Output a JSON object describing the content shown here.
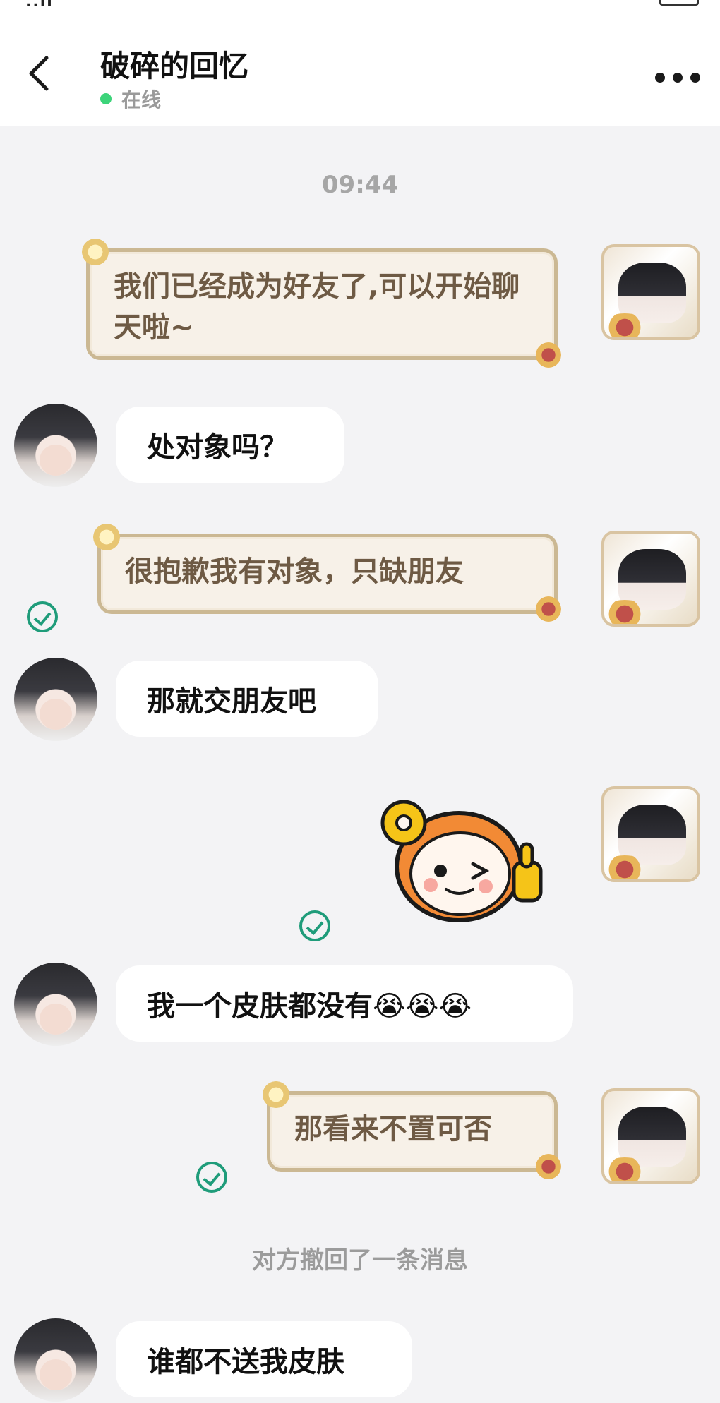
{
  "status_bar": {
    "signal": "..ıl"
  },
  "header": {
    "title": "破碎的回忆",
    "status": "在线"
  },
  "chat": {
    "timestamp": "09:44",
    "messages": [
      {
        "side": "out",
        "text": "我们已经成为好友了,可以开始聊天啦~"
      },
      {
        "side": "in",
        "text": "处对象吗？"
      },
      {
        "side": "out",
        "text": "很抱歉我有对象，只缺朋友"
      },
      {
        "side": "in",
        "text": "那就交朋友吧"
      },
      {
        "side": "out",
        "type": "sticker",
        "icon": "ok-thumbs-up-wink-sticker"
      },
      {
        "side": "in",
        "text": "我一个皮肤都没有😭😭😭"
      },
      {
        "side": "out",
        "text": "那看来不置可否"
      },
      {
        "side": "system",
        "text": "对方撤回了一条消息"
      },
      {
        "side": "in",
        "text": "谁都不送我皮肤"
      }
    ]
  },
  "colors": {
    "online": "#3dd47a",
    "read_check": "#1f9c7a",
    "outgoing_text": "#6e5a44",
    "outgoing_border": "#cbb893",
    "background": "#f3f3f5"
  },
  "icons": {
    "back": "chevron-left-icon",
    "more": "more-dots-icon",
    "read": "check-circle-icon"
  }
}
